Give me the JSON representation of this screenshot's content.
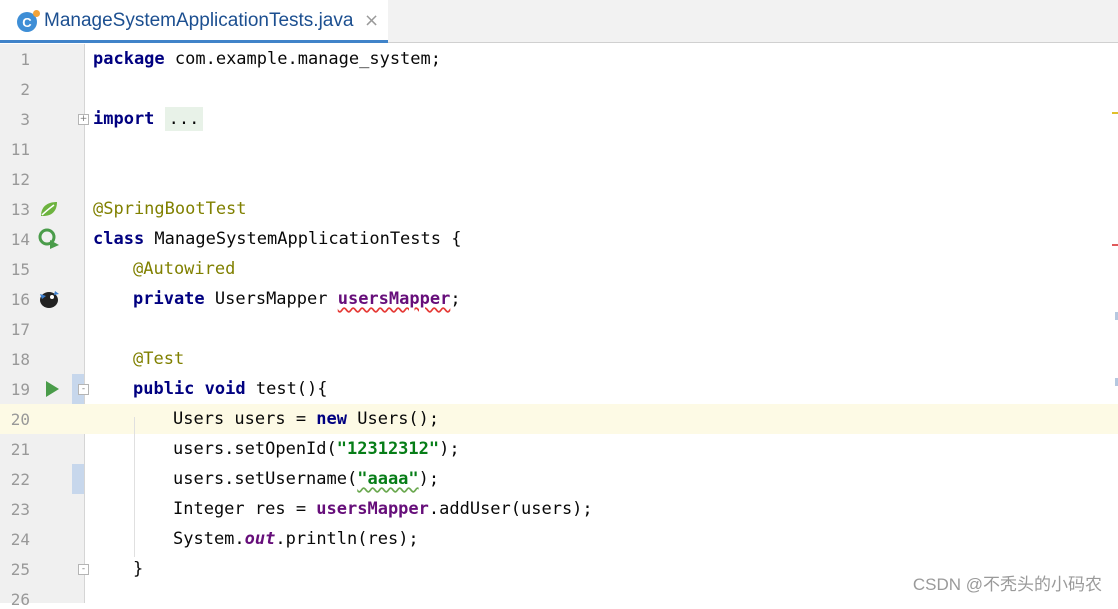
{
  "tab": {
    "title": "ManageSystemApplicationTests.java",
    "close": "×",
    "icon": "java-class-icon",
    "icon_letter": "C"
  },
  "line_numbers": [
    "1",
    "2",
    "3",
    "11",
    "12",
    "13",
    "14",
    "15",
    "16",
    "17",
    "18",
    "19",
    "20",
    "21",
    "22",
    "23",
    "24",
    "25",
    "26"
  ],
  "code": {
    "l1_kw": "package",
    "l1_rest": " com.example.manage_system;",
    "l3_kw": "import",
    "l3_fold": "...",
    "l13_ann": "@SpringBootTest",
    "l14_kw": "class",
    "l14_rest": " ManageSystemApplicationTests {",
    "l15_ann": "@Autowired",
    "l16_kw": "private",
    "l16_type": " UsersMapper ",
    "l16_field": "usersMapper",
    "l16_end": ";",
    "l18_ann": "@Test",
    "l19_kw1": "public",
    "l19_kw2": "void",
    "l19_rest": " test(){",
    "l20_a": "Users users = ",
    "l20_kw": "new",
    "l20_b": " Users();",
    "l21_a": "users.setOpenId(",
    "l21_str": "\"12312312\"",
    "l21_b": ");",
    "l22_a": "users.setUsername(",
    "l22_str": "\"aaaa\"",
    "l22_b": ");",
    "l23_a": "Integer res = ",
    "l23_field": "usersMapper",
    "l23_b": ".addUser(users);",
    "l24_a": "System.",
    "l24_static": "out",
    "l24_b": ".println(res);",
    "l25": "}"
  },
  "watermark": "CSDN @不秃头的小码农",
  "colors": {
    "keyword": "#000080",
    "annotation": "#808000",
    "string": "#067d17",
    "field": "#660e7a",
    "current_line": "#fdfae5"
  }
}
